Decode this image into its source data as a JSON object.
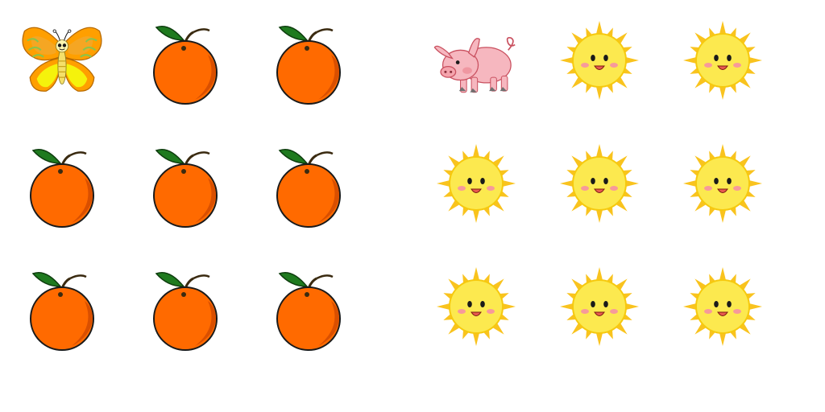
{
  "panels": [
    {
      "name": "left-panel",
      "items": [
        "butterfly",
        "orange",
        "orange",
        "orange",
        "orange",
        "orange",
        "orange",
        "orange",
        "orange"
      ]
    },
    {
      "name": "right-panel",
      "items": [
        "pig",
        "sun",
        "sun",
        "sun",
        "sun",
        "sun",
        "sun",
        "sun",
        "sun"
      ]
    }
  ],
  "colors": {
    "orange_fruit": "#ff6a00",
    "leaf": "#1f7a1f",
    "sun_face": "#fce94f",
    "sun_rays": "#f9c31e",
    "pig": "#f6b7bf",
    "butterfly_wing": "#ff9f00",
    "butterfly_inner": "#f5f20c"
  }
}
